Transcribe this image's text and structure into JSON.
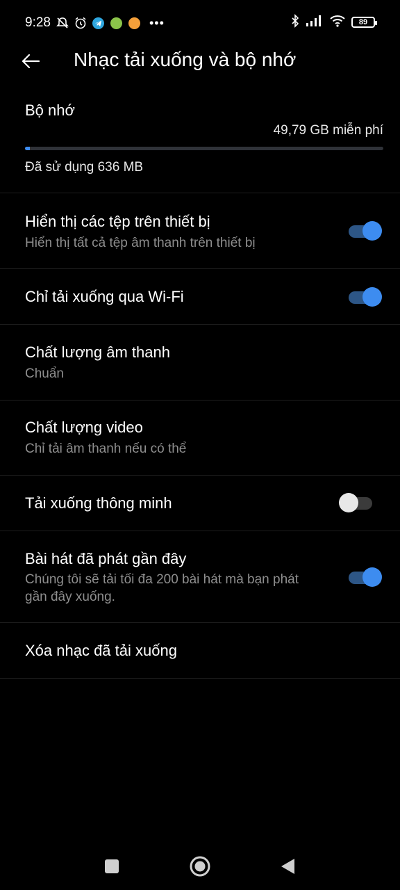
{
  "status_bar": {
    "time": "9:28",
    "battery": "89",
    "icons": [
      "mute-bell-icon",
      "alarm-icon",
      "telegram-icon",
      "app-icon",
      "app-icon",
      "more-dots",
      "bluetooth-icon",
      "signal-icon",
      "wifi-icon",
      "battery-icon"
    ],
    "dots": "•••"
  },
  "header": {
    "title": "Nhạc tải xuống và bộ nhớ"
  },
  "storage": {
    "title": "Bộ nhớ",
    "free": "49,79 GB miễn phí",
    "used": "Đã sử dụng 636 MB",
    "used_fraction": 0.013
  },
  "settings": [
    {
      "title": "Hiển thị các tệp trên thiết bị",
      "subtitle": "Hiển thị tất cả tệp âm thanh trên thiết bị",
      "toggle": true
    },
    {
      "title": "Chỉ tải xuống qua Wi-Fi",
      "toggle": true
    },
    {
      "title": "Chất lượng âm thanh",
      "subtitle": "Chuẩn"
    },
    {
      "title": "Chất lượng video",
      "subtitle": "Chỉ tải âm thanh nếu có thể"
    },
    {
      "title": "Tải xuống thông minh",
      "toggle": false
    },
    {
      "title": "Bài hát đã phát gần đây",
      "subtitle": "Chúng tôi sẽ tải tối đa 200 bài hát mà bạn phát gần đây xuống.",
      "toggle": true
    },
    {
      "title": "Xóa nhạc đã tải xuống"
    }
  ],
  "colors": {
    "accent": "#3d8cf0",
    "background": "#000000",
    "subtitle": "#8e8e8e"
  }
}
